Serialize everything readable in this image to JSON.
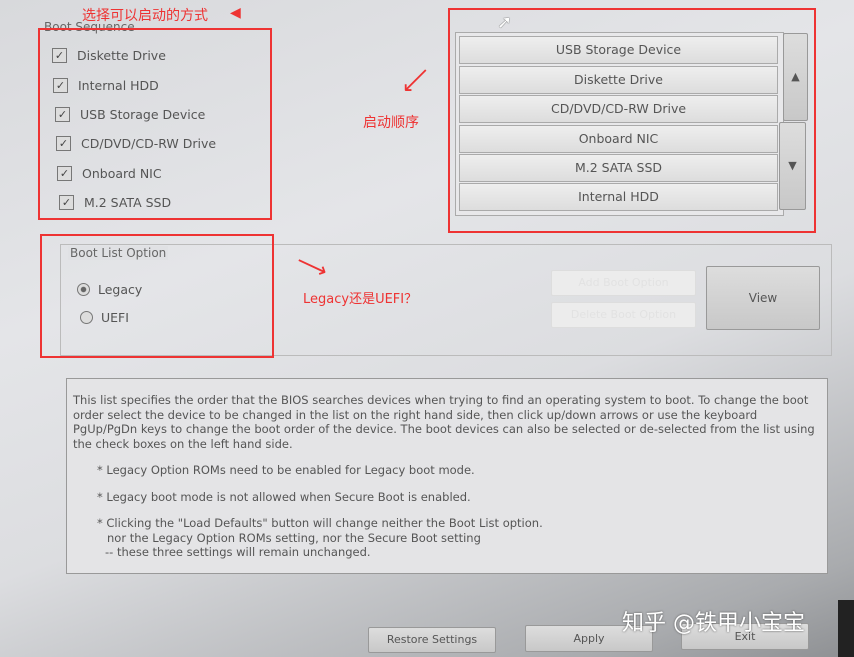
{
  "boot_sequence": {
    "title": "Boot Sequence",
    "devices": [
      {
        "label": "Diskette Drive",
        "checked": true
      },
      {
        "label": "Internal HDD",
        "checked": true
      },
      {
        "label": "USB Storage Device",
        "checked": true
      },
      {
        "label": "CD/DVD/CD-RW Drive",
        "checked": true
      },
      {
        "label": "Onboard NIC",
        "checked": true
      },
      {
        "label": "M.2 SATA SSD",
        "checked": true
      }
    ],
    "order": [
      "USB Storage Device",
      "Diskette Drive",
      "CD/DVD/CD-RW Drive",
      "Onboard NIC",
      "M.2 SATA SSD",
      "Internal HDD"
    ]
  },
  "boot_list": {
    "title": "Boot List Option",
    "options": [
      "Legacy",
      "UEFI"
    ],
    "selected": "Legacy"
  },
  "buttons": {
    "add": "Add Boot Option",
    "delete": "Delete Boot Option",
    "view": "View",
    "restore": "Restore Settings",
    "apply": "Apply",
    "exit": "Exit"
  },
  "help": {
    "para": "This list specifies the order that the BIOS searches devices when trying to find an operating system to boot. To change the boot order select the device to be changed in the list on the right hand side, then click up/down arrows or use the keyboard PgUp/PgDn keys to change the boot order of the device. The boot devices can also be selected or de-selected from the list using the check boxes on the left hand side.",
    "bullet1": "* Legacy Option ROMs need to be enabled for Legacy boot mode.",
    "bullet2": "* Legacy boot mode is not allowed when Secure Boot is enabled.",
    "bullet3a": "* Clicking the \"Load Defaults\" button will change neither the Boot List option.",
    "bullet3b": "nor the Legacy Option ROMs setting, nor the Secure Boot setting",
    "bullet3c": "-- these three settings will remain unchanged."
  },
  "annotations": {
    "select": "选择可以启动的方式",
    "order": "启动顺序",
    "mode": "Legacy还是UEFI？"
  },
  "watermark": "知乎 @铁甲小宝宝",
  "colors": {
    "annotation": "#e33333"
  }
}
